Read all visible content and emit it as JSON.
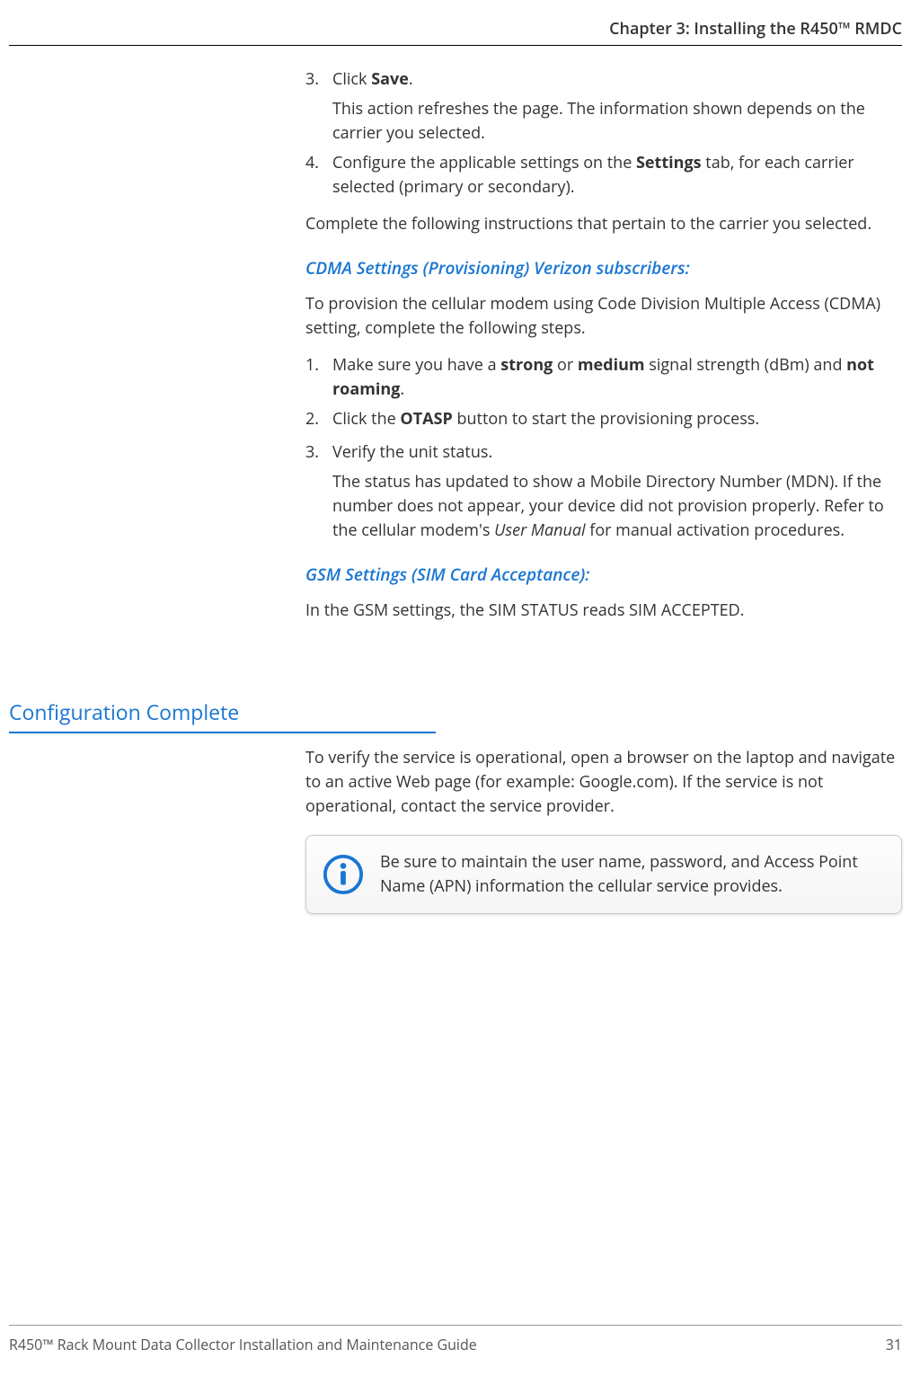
{
  "header": {
    "title": "Chapter 3: Installing the R450™ RMDC"
  },
  "content": {
    "list1": {
      "item3": {
        "marker": "3.",
        "textPre": "Click ",
        "bold": "Save",
        "textPost": ".",
        "sub": "This action refreshes the page. The information shown depends on the carrier you selected."
      },
      "item4": {
        "marker": "4.",
        "pre": "Configure the applicable settings on the ",
        "bold": "Settings",
        "post": " tab, for each carrier selected (primary or secondary)."
      }
    },
    "para1": "Complete the following instructions that pertain to the carrier you selected.",
    "subhead1": "CDMA Settings (Provisioning) Verizon subscribers:",
    "para2": "To provision the cellular modem using Code Division Multiple Access (CDMA) setting, complete the following steps.",
    "list2": {
      "item1": {
        "marker": "1.",
        "pre": "Make sure you have a ",
        "b1": "strong",
        "mid1": " or ",
        "b2": "medium",
        "mid2": " signal strength (dBm) and ",
        "b3": "not roaming",
        "post": "."
      },
      "item2": {
        "marker": "2.",
        "pre": "Click the ",
        "b1": "OTASP",
        "post": " button to start the provisioning process."
      },
      "item3": {
        "marker": "3.",
        "text": "Verify the unit status.",
        "subPre": "The status has updated to show a Mobile Directory Number (MDN). If the number does not appear, your device did not provision properly. Refer to the cellular modem's ",
        "subItal": "User Manual",
        "subPost": " for manual activation procedures."
      }
    },
    "subhead2": "GSM Settings (SIM Card Acceptance):",
    "para3": "In the GSM settings, the SIM STATUS reads SIM ACCEPTED."
  },
  "section": {
    "heading": "Configuration Complete",
    "para": "To verify the service is operational, open a browser on the laptop and navigate to an active Web page (for example: Google.com). If the service is not operational, contact the service provider.",
    "note": "Be sure to maintain the user name, password, and Access Point Name (APN) information the cellular service provides."
  },
  "footer": {
    "left": "R450™ Rack Mount Data Collector Installation and Maintenance Guide",
    "right": "31"
  }
}
